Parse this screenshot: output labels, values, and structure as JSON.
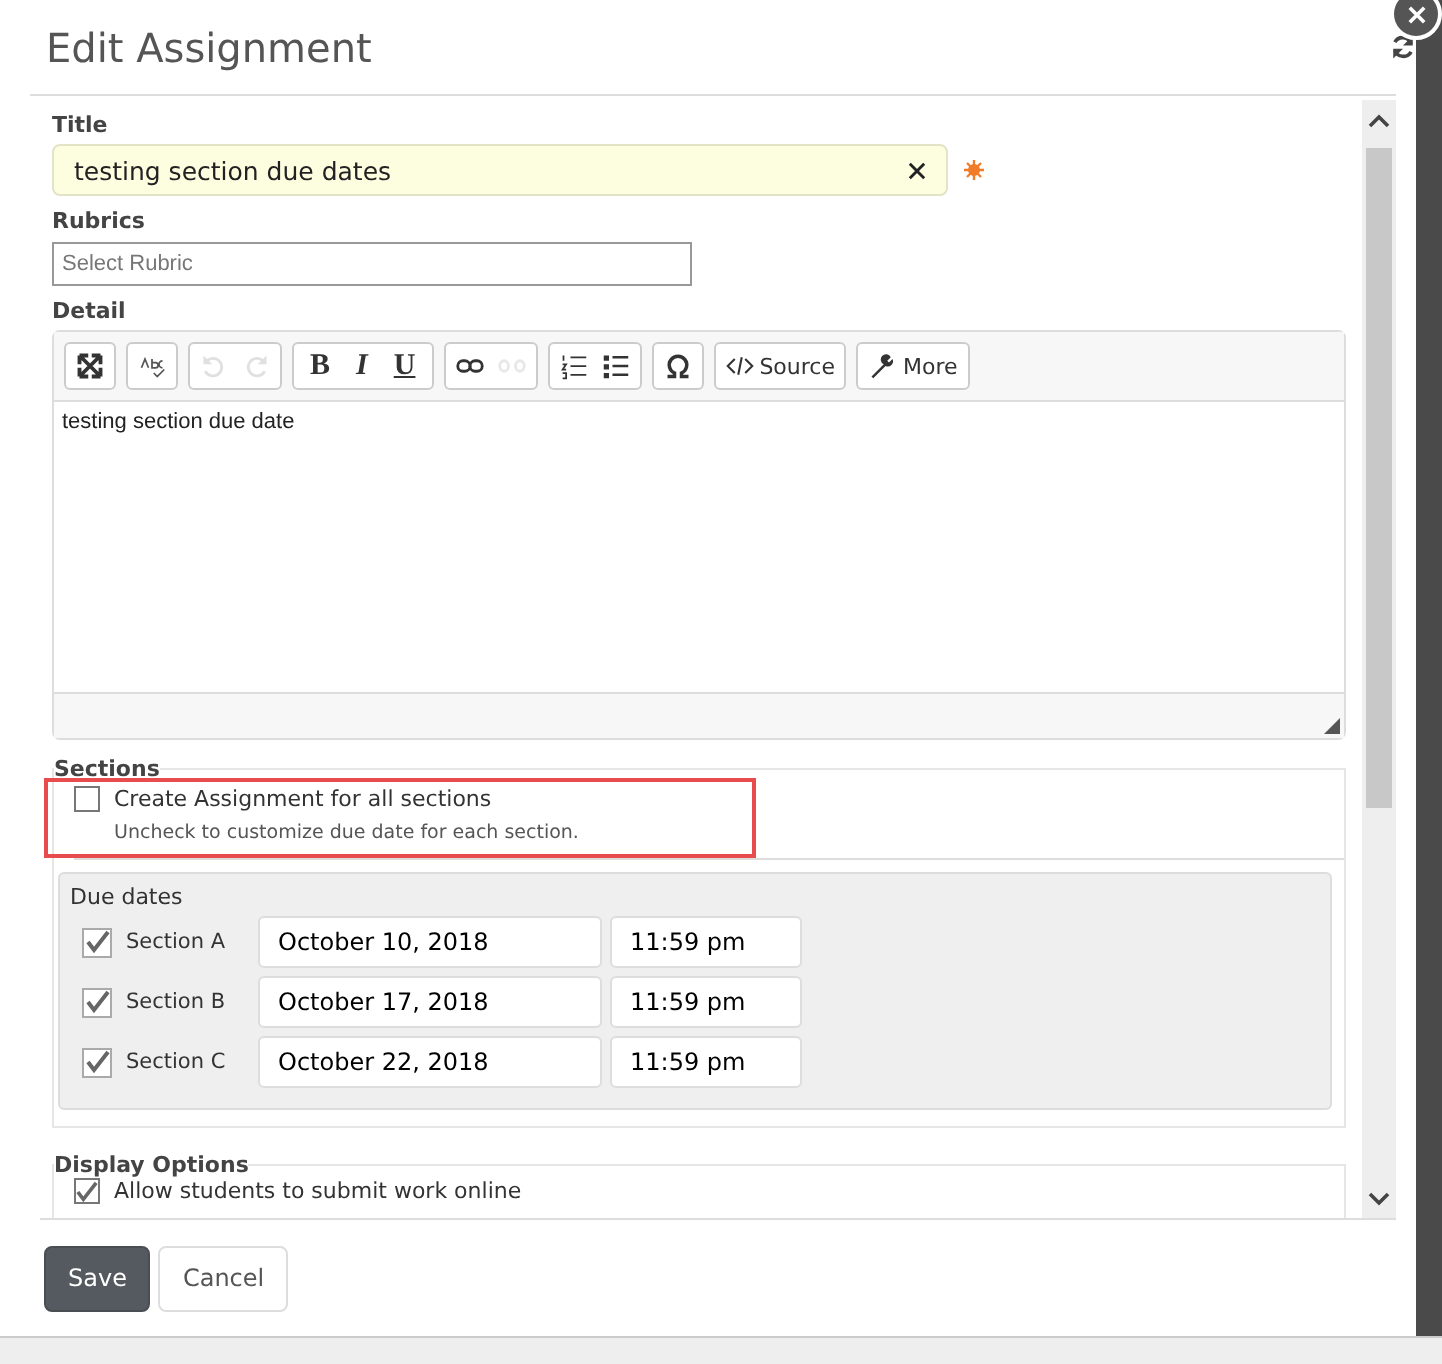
{
  "dialog": {
    "title": "Edit Assignment"
  },
  "title_field": {
    "label": "Title",
    "value": "testing section due dates",
    "required": true
  },
  "rubrics_field": {
    "label": "Rubrics",
    "placeholder": "Select Rubric"
  },
  "detail": {
    "label": "Detail",
    "toolbar": [
      [
        {
          "kind": "maximize",
          "disabled": false
        }
      ],
      [
        {
          "kind": "spellcheck",
          "disabled": false
        }
      ],
      [
        {
          "kind": "undo",
          "disabled": true
        },
        {
          "kind": "redo",
          "disabled": true
        }
      ],
      [
        {
          "kind": "bold",
          "disabled": false,
          "label": "B"
        },
        {
          "kind": "italic",
          "disabled": false,
          "label": "I"
        },
        {
          "kind": "underline",
          "disabled": false,
          "label": "U"
        }
      ],
      [
        {
          "kind": "link",
          "disabled": false
        },
        {
          "kind": "unlink",
          "disabled": true
        }
      ],
      [
        {
          "kind": "numbered-list",
          "disabled": false
        },
        {
          "kind": "bulleted-list",
          "disabled": false
        }
      ],
      [
        {
          "kind": "omega",
          "disabled": false
        }
      ],
      [
        {
          "kind": "source",
          "disabled": false,
          "label": "Source"
        }
      ],
      [
        {
          "kind": "more",
          "disabled": false,
          "label": "More"
        }
      ]
    ],
    "body": "testing section due date"
  },
  "sections": {
    "legend": "Sections",
    "all_checkbox": {
      "label": "Create Assignment for all sections",
      "checked": false
    },
    "hint": "Uncheck to customize due date for each section.",
    "due_dates_label": "Due dates",
    "rows": [
      {
        "name": "Section A",
        "checked": true,
        "date": "October 10, 2018",
        "time": "11:59 pm"
      },
      {
        "name": "Section B",
        "checked": true,
        "date": "October 17, 2018",
        "time": "11:59 pm"
      },
      {
        "name": "Section C",
        "checked": true,
        "date": "October 22, 2018",
        "time": "11:59 pm"
      }
    ]
  },
  "display_options": {
    "legend": "Display Options",
    "items": [
      {
        "label": "Allow students to submit work online",
        "checked": true
      }
    ]
  },
  "buttons": [
    {
      "label": "Save",
      "kind": "primary"
    },
    {
      "label": "Cancel",
      "kind": "secondary"
    }
  ]
}
